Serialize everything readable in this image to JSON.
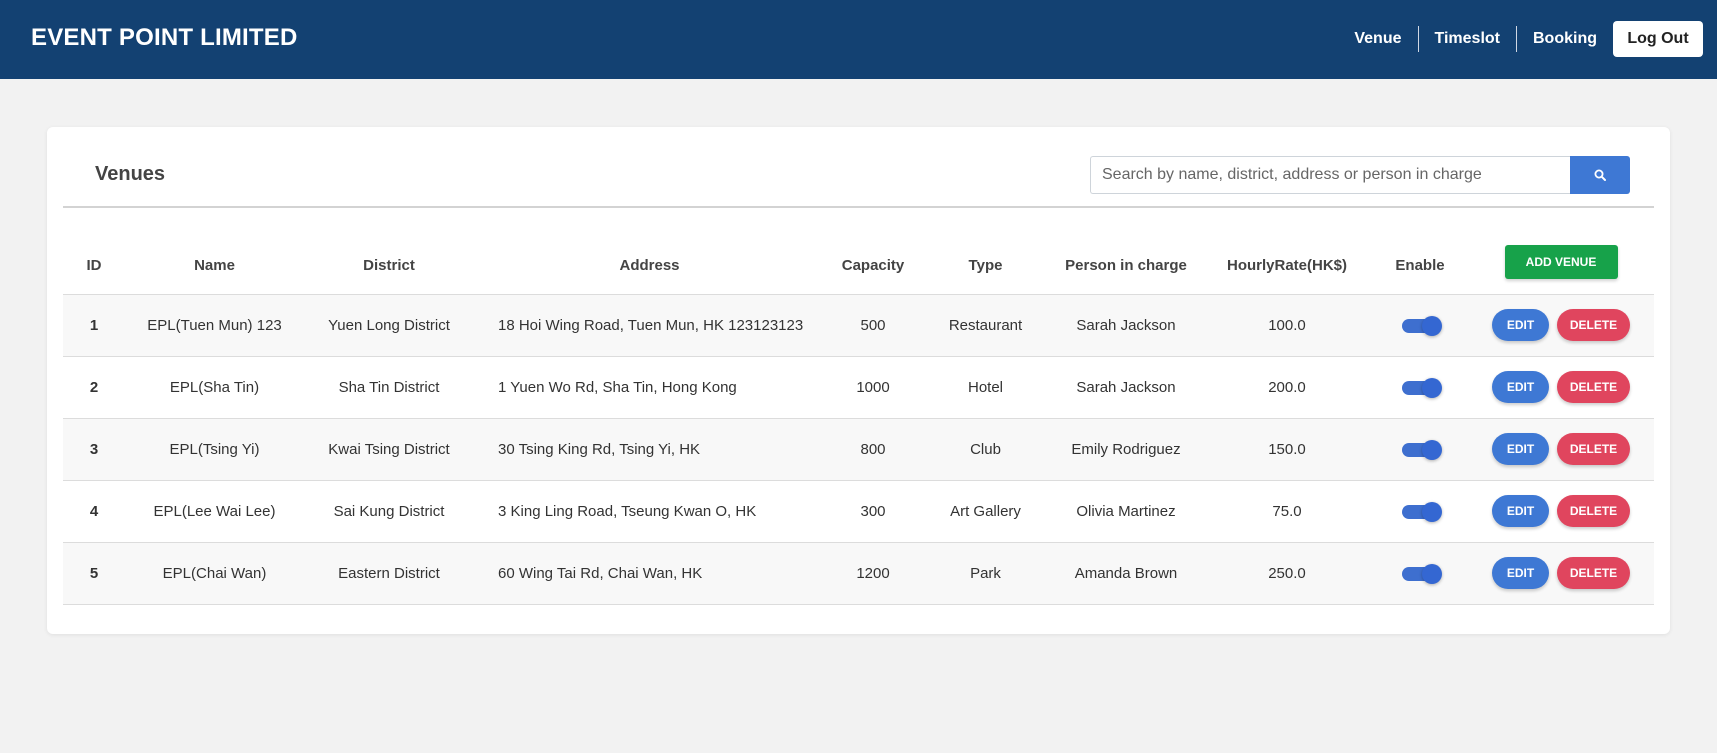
{
  "brand": "EVENT POINT LIMITED",
  "nav": {
    "venue": "Venue",
    "timeslot": "Timeslot",
    "booking": "Booking",
    "logout": "Log Out"
  },
  "card": {
    "title": "Venues",
    "search_placeholder": "Search by name, district, address or person in charge",
    "search_icon": "search-icon",
    "add_label": "ADD VENUE"
  },
  "columns": [
    "ID",
    "Name",
    "District",
    "Address",
    "Capacity",
    "Type",
    "Person in charge",
    "HourlyRate(HK$)",
    "Enable"
  ],
  "rows": [
    {
      "id": "1",
      "name": "EPL(Tuen Mun) 123",
      "district": "Yuen Long District",
      "address": "18 Hoi Wing Road, Tuen Mun, HK 123123123",
      "capacity": "500",
      "type": "Restaurant",
      "person": "Sarah Jackson",
      "rate": "100.0",
      "enabled": true
    },
    {
      "id": "2",
      "name": "EPL(Sha Tin)",
      "district": "Sha Tin District",
      "address": "1 Yuen Wo Rd, Sha Tin, Hong Kong",
      "capacity": "1000",
      "type": "Hotel",
      "person": "Sarah Jackson",
      "rate": "200.0",
      "enabled": true
    },
    {
      "id": "3",
      "name": "EPL(Tsing Yi)",
      "district": "Kwai Tsing District",
      "address": "30 Tsing King Rd, Tsing Yi, HK",
      "capacity": "800",
      "type": "Club",
      "person": "Emily Rodriguez",
      "rate": "150.0",
      "enabled": true
    },
    {
      "id": "4",
      "name": "EPL(Lee Wai Lee)",
      "district": "Sai Kung District",
      "address": "3 King Ling Road, Tseung Kwan O, HK",
      "capacity": "300",
      "type": "Art Gallery",
      "person": "Olivia Martinez",
      "rate": "75.0",
      "enabled": true
    },
    {
      "id": "5",
      "name": "EPL(Chai Wan)",
      "district": "Eastern District",
      "address": "60 Wing Tai Rd, Chai Wan, HK",
      "capacity": "1200",
      "type": "Park",
      "person": "Amanda Brown",
      "rate": "250.0",
      "enabled": true
    }
  ],
  "row_actions": {
    "edit": "EDIT",
    "delete": "DELETE"
  },
  "colors": {
    "navbar": "#134172",
    "primary": "#3e78d4",
    "success": "#17a24a",
    "danger": "#e0455e",
    "background": "#f2f2f2"
  }
}
